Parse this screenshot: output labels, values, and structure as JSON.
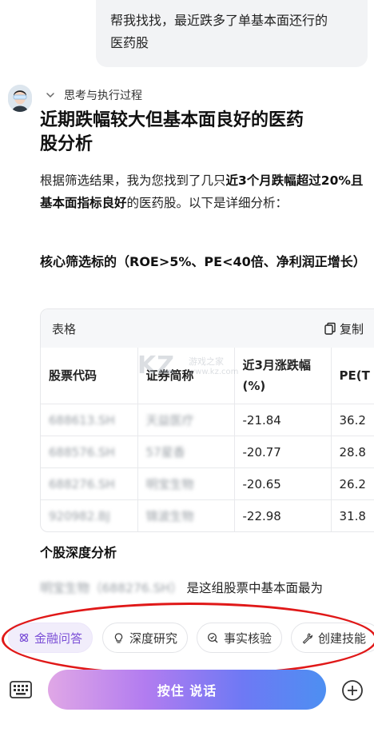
{
  "user_message": {
    "line1": "帮我找找，最近跌多了单基本面还行的",
    "line2": "医药股"
  },
  "assistant": {
    "think_label": "思考与执行过程",
    "title_line1": "近期跌幅较大但基本面良好的医药",
    "title_line2": "股分析",
    "intro_part1": "根据筛选结果，我为您找到了几只",
    "intro_bold": "近3个月跌幅超过20%且基本面指标良好",
    "intro_part2": "的医药股。以下是详细分析：",
    "core_section": "核心筛选标的（ROE>5%、PE<40倍、净利润正增长）",
    "table": {
      "label": "表格",
      "copy_label": "复制",
      "headers": [
        "股票代码",
        "证券简称",
        "近3月涨跌幅(%)",
        "PE(T"
      ],
      "rows": [
        {
          "code": "688613.SH",
          "name": "天益医疗",
          "change": "-21.84",
          "pe": "36.2"
        },
        {
          "code": "688576.SH",
          "name": "57星香",
          "change": "-20.77",
          "pe": "28.8"
        },
        {
          "code": "688276.SH",
          "name": "明宝生物",
          "change": "-20.65",
          "pe": "26.2"
        },
        {
          "code": "920982.BJ",
          "name": "锦波生物",
          "change": "-22.98",
          "pe": "31.8"
        }
      ]
    },
    "deep_section": "个股深度分析",
    "deep_blur_name": "明宝生物（688276.SH）",
    "deep_text": "是这组股票中基本面最为"
  },
  "chips": [
    {
      "label": "金融问答",
      "icon": "atom-icon",
      "active": true
    },
    {
      "label": "深度研究",
      "icon": "bulb-icon",
      "active": false
    },
    {
      "label": "事实核验",
      "icon": "check-search-icon",
      "active": false
    },
    {
      "label": "创建技能",
      "icon": "wrench-icon",
      "active": false
    }
  ],
  "bottom": {
    "talk_label": "按住 说话"
  },
  "watermark": {
    "big": "KZ",
    "small": "游戏之家",
    "url": "www.kz.com"
  },
  "colors": {
    "accent_purple": "#7b4fd6",
    "highlight_ring": "#e01818",
    "talk_gradient_start": "#e0a7e6",
    "talk_gradient_end": "#4d8ff2"
  }
}
